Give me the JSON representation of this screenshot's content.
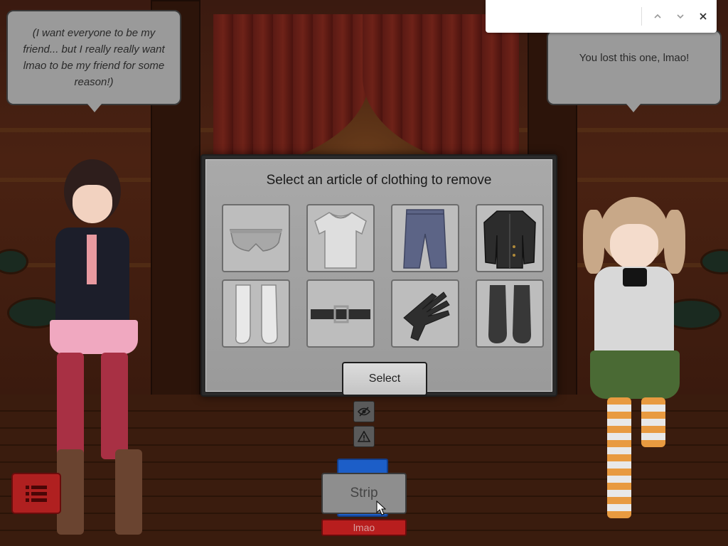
{
  "left_bubble": {
    "text": "(I want everyone to be my friend... but I really really want lmao to be my friend for some reason!)"
  },
  "right_bubble": {
    "text": "You lost this one, lmao!"
  },
  "find_bar": {
    "value": "",
    "prev_icon": "chevron-up-icon",
    "next_icon": "chevron-down-icon",
    "close_icon": "close-icon"
  },
  "modal": {
    "title": "Select an article of clothing to remove",
    "select_label": "Select",
    "items": [
      {
        "icon": "panties-icon"
      },
      {
        "icon": "shirt-icon"
      },
      {
        "icon": "jeans-icon"
      },
      {
        "icon": "jacket-icon"
      },
      {
        "icon": "stockings-icon"
      },
      {
        "icon": "belt-icon"
      },
      {
        "icon": "glove-icon"
      },
      {
        "icon": "boots-icon"
      }
    ]
  },
  "controls": {
    "hide_icon": "eye-slash-icon",
    "report_icon": "warning-icon",
    "menu_icon": "list-icon",
    "strip_label": "Strip",
    "player_name": "lmao"
  }
}
